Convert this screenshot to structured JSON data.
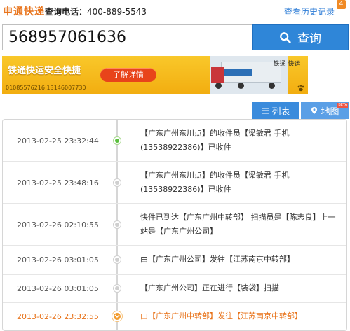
{
  "header": {
    "brand": "申通快递",
    "phone_label": "查询电话：",
    "phone_number": "400-889-5543",
    "history_link": "查看历史记录",
    "history_count": "4"
  },
  "search": {
    "value": "568957061636",
    "button_label": "查询"
  },
  "banner": {
    "title": "铁通快运安全快捷",
    "button_label": "了解详情",
    "phones": "01085576216  13146007730",
    "logo_text": "铁通 快运"
  },
  "tabs": [
    {
      "label": "列表",
      "active": true
    },
    {
      "label": "地图",
      "badge": "BETA"
    }
  ],
  "records": [
    {
      "time": "2013-02-25 23:32:44",
      "desc": "【广东广州东川点】的收件员【梁敏君 手机(13538922386)】已收件"
    },
    {
      "time": "2013-02-25 23:48:16",
      "desc": "【广东广州东川点】的收件员【梁敏君 手机(13538922386)】已收件"
    },
    {
      "time": "2013-02-26 02:10:55",
      "desc": "快件已到达【广东广州中转部】 扫描员是【陈志良】上一站是【广东广州公司】"
    },
    {
      "time": "2013-02-26 03:01:05",
      "desc": "由【广东广州公司】发往【江苏南京中转部】"
    },
    {
      "time": "2013-02-26 03:01:05",
      "desc": "【广东广州公司】正在进行【装袋】扫描"
    },
    {
      "time": "2013-02-26 23:32:55",
      "desc": "由【广东广州中转部】发往【江苏南京中转部】"
    }
  ],
  "colors": {
    "brand": "#e8731a",
    "accent_blue": "#2f86d8",
    "highlight": "#e8731a",
    "first_dot": "#5bbf3e"
  }
}
